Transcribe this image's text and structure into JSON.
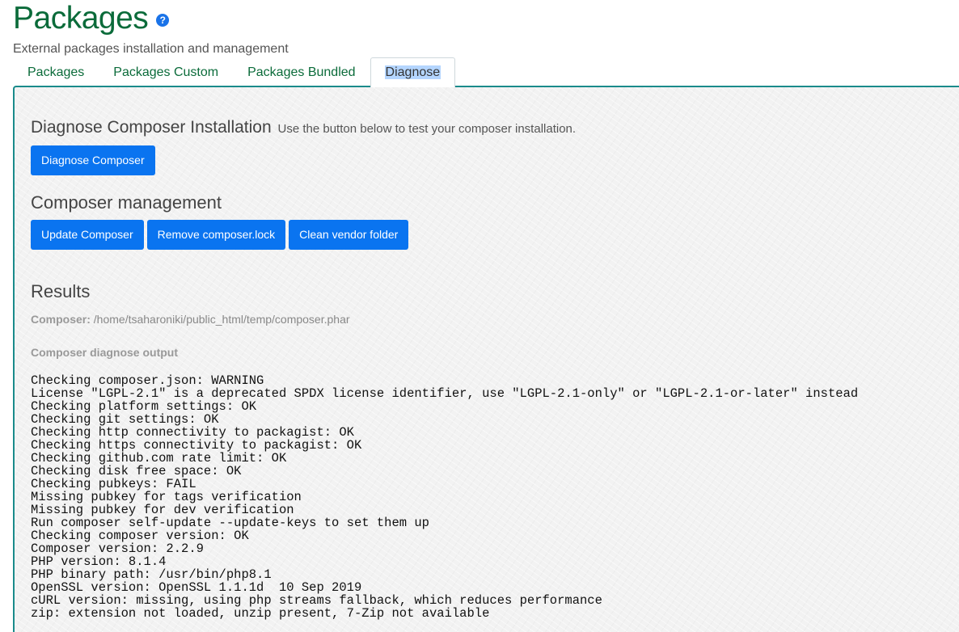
{
  "header": {
    "title": "Packages",
    "help_icon": "?",
    "subtitle": "External packages installation and management"
  },
  "tabs": [
    {
      "label": "Packages",
      "active": false
    },
    {
      "label": "Packages Custom",
      "active": false
    },
    {
      "label": "Packages Bundled",
      "active": false
    },
    {
      "label": "Diagnose",
      "active": true
    }
  ],
  "diagnose": {
    "heading": "Diagnose Composer Installation",
    "description": "Use the button below to test your composer installation.",
    "button": "Diagnose Composer"
  },
  "management": {
    "heading": "Composer management",
    "buttons": [
      "Update Composer",
      "Remove composer.lock",
      "Clean vendor folder"
    ]
  },
  "results": {
    "heading": "Results",
    "composer_label": "Composer:",
    "composer_path": "/home/tsaharoniki/public_html/temp/composer.phar",
    "output_label": "Composer diagnose output",
    "output_lines": [
      "Checking composer.json: WARNING",
      "License \"LGPL-2.1\" is a deprecated SPDX license identifier, use \"LGPL-2.1-only\" or \"LGPL-2.1-or-later\" instead",
      "Checking platform settings: OK",
      "Checking git settings: OK",
      "Checking http connectivity to packagist: OK",
      "Checking https connectivity to packagist: OK",
      "Checking github.com rate limit: OK",
      "Checking disk free space: OK",
      "Checking pubkeys: FAIL",
      "Missing pubkey for tags verification",
      "Missing pubkey for dev verification",
      "Run composer self-update --update-keys to set them up",
      "Checking composer version: OK",
      "Composer version: 2.2.9",
      "PHP version: 8.1.4",
      "PHP binary path: /usr/bin/php8.1",
      "OpenSSL version: OpenSSL 1.1.1d  10 Sep 2019",
      "cURL version: missing, using php streams fallback, which reduces performance",
      "zip: extension not loaded, unzip present, 7-Zip not available"
    ]
  },
  "colors": {
    "title_green": "#0b6b3a",
    "button_blue": "#0a74f0",
    "panel_border": "#1a8b8b"
  }
}
